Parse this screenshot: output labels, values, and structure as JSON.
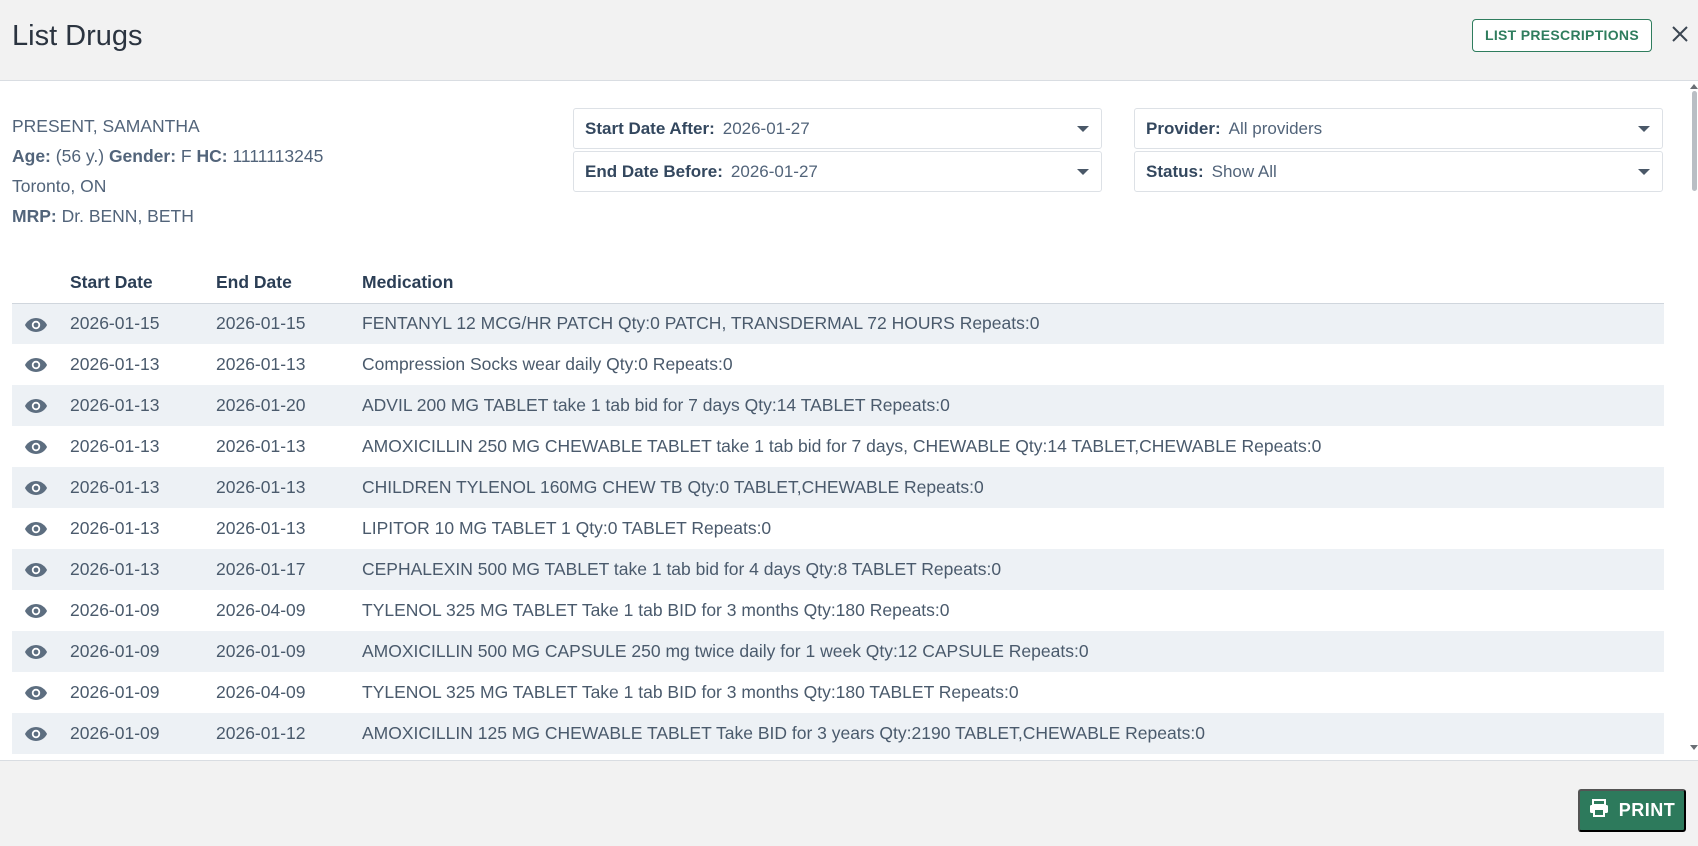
{
  "header": {
    "title": "List Drugs",
    "list_prescriptions_label": "LIST PRESCRIPTIONS",
    "close_icon": "close-icon"
  },
  "patient": {
    "name": "PRESENT, SAMANTHA",
    "age_label": "Age:",
    "age_value": "(56 y.)",
    "gender_label": "Gender:",
    "gender_value": "F",
    "hc_label": "HC:",
    "hc_value": "1111113245",
    "location": "Toronto, ON",
    "mrp_label": "MRP:",
    "mrp_value": "Dr. BENN, BETH"
  },
  "filters": {
    "start_date": {
      "label": "Start Date After:",
      "value": "2026-01-27"
    },
    "end_date": {
      "label": "End Date Before:",
      "value": "2026-01-27"
    },
    "provider": {
      "label": "Provider:",
      "value": "All providers"
    },
    "status": {
      "label": "Status:",
      "value": "Show All"
    }
  },
  "table": {
    "columns": [
      "",
      "Start Date",
      "End Date",
      "Medication"
    ],
    "rows": [
      {
        "start": "2026-01-15",
        "end": "2026-01-15",
        "medication": "FENTANYL 12 MCG/HR PATCH Qty:0 PATCH, TRANSDERMAL 72 HOURS Repeats:0"
      },
      {
        "start": "2026-01-13",
        "end": "2026-01-13",
        "medication": "Compression Socks wear daily Qty:0 Repeats:0"
      },
      {
        "start": "2026-01-13",
        "end": "2026-01-20",
        "medication": "ADVIL 200 MG TABLET take 1 tab bid for 7 days Qty:14 TABLET Repeats:0"
      },
      {
        "start": "2026-01-13",
        "end": "2026-01-13",
        "medication": "AMOXICILLIN 250 MG CHEWABLE TABLET take 1 tab bid for 7 days, CHEWABLE Qty:14 TABLET,CHEWABLE Repeats:0"
      },
      {
        "start": "2026-01-13",
        "end": "2026-01-13",
        "medication": "CHILDREN TYLENOL 160MG CHEW TB Qty:0 TABLET,CHEWABLE Repeats:0"
      },
      {
        "start": "2026-01-13",
        "end": "2026-01-13",
        "medication": "LIPITOR 10 MG TABLET 1 Qty:0 TABLET Repeats:0"
      },
      {
        "start": "2026-01-13",
        "end": "2026-01-17",
        "medication": "CEPHALEXIN 500 MG TABLET take 1 tab bid for 4 days Qty:8 TABLET Repeats:0"
      },
      {
        "start": "2026-01-09",
        "end": "2026-04-09",
        "medication": "TYLENOL 325 MG TABLET Take 1 tab BID for 3 months Qty:180 Repeats:0"
      },
      {
        "start": "2026-01-09",
        "end": "2026-01-09",
        "medication": "AMOXICILLIN 500 MG CAPSULE 250 mg twice daily for 1 week Qty:12 CAPSULE Repeats:0"
      },
      {
        "start": "2026-01-09",
        "end": "2026-04-09",
        "medication": "TYLENOL 325 MG TABLET Take 1 tab BID for 3 months Qty:180 TABLET Repeats:0"
      },
      {
        "start": "2026-01-09",
        "end": "2026-01-12",
        "medication": "AMOXICILLIN 125 MG CHEWABLE TABLET Take BID for 3 years Qty:2190 TABLET,CHEWABLE Repeats:0"
      }
    ],
    "row_icon": "eye-icon"
  },
  "footer": {
    "print_label": "PRINT",
    "print_icon": "printer-icon"
  },
  "colors": {
    "accent_green": "#2d7a5c",
    "row_stripe": "#edf1f5",
    "text": "#4a5a6c"
  }
}
